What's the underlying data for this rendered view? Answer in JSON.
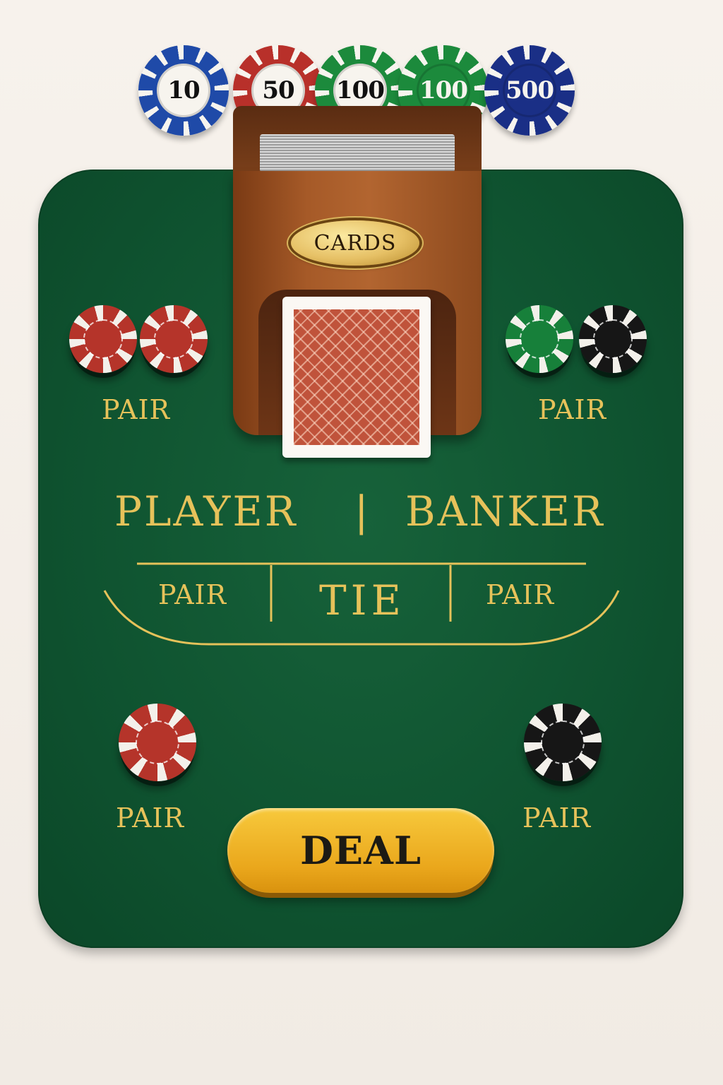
{
  "chip_rack": [
    {
      "value": "10",
      "rim": "#1f4aa8",
      "face": "#f7f4ee",
      "text": "#111111"
    },
    {
      "value": "50",
      "rim": "#b8302a",
      "face": "#f7f4ee",
      "text": "#111111"
    },
    {
      "value": "100",
      "rim": "#1c8a3c",
      "face": "#f7f4ee",
      "text": "#111111"
    },
    {
      "value": "100",
      "rim": "#1c8a3c",
      "face": "#1c8a3c",
      "text": "#f7f4ee"
    },
    {
      "value": "500",
      "rim": "#1a2f86",
      "face": "#1a2f86",
      "text": "#f7f4ee"
    }
  ],
  "shoe": {
    "plaque_label": "CARDS"
  },
  "bets": {
    "upper_left_pair": "PAIR",
    "upper_right_pair": "PAIR",
    "player": "PLAYER",
    "separator": "|",
    "banker": "BANKER",
    "player_pair": "PAIR",
    "tie": "TIE",
    "banker_pair": "PAIR",
    "lower_left_pair": "PAIR",
    "lower_right_pair": "PAIR"
  },
  "table_chips": {
    "red": "#b5342a",
    "green": "#17803a",
    "black": "#161616"
  },
  "deal_button": {
    "label": "DEAL"
  },
  "colors": {
    "felt": "#0f5330",
    "gold": "#e6c25a",
    "button": "#f2b62c"
  }
}
